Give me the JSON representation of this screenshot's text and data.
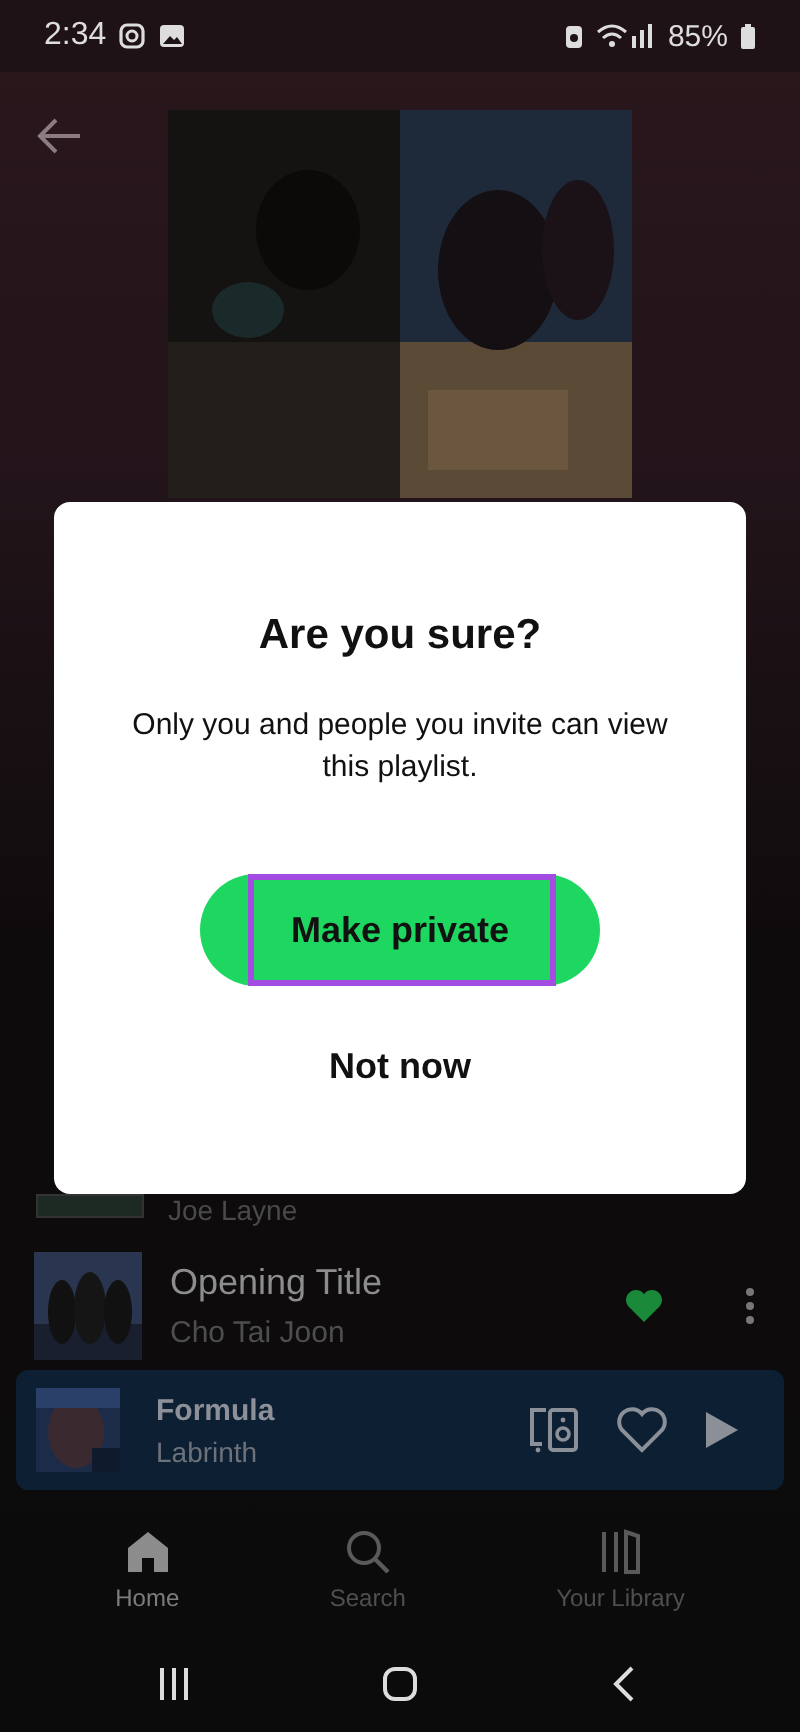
{
  "status_bar": {
    "time": "2:34",
    "battery": "85%"
  },
  "partial_track": {
    "artist": "Joe Layne"
  },
  "tracks": [
    {
      "title": "Opening Title",
      "artist": "Cho Tai Joon",
      "liked": true
    }
  ],
  "dialog": {
    "title": "Are you sure?",
    "message": "Only you and people you invite can view this playlist.",
    "buttons": [
      {
        "label": "Make private",
        "kind": "primary",
        "highlighted": true
      },
      {
        "label": "Not now",
        "kind": "text",
        "highlighted": false
      }
    ]
  },
  "now_playing": {
    "title": "Formula",
    "artist": "Labrinth",
    "liked": false
  },
  "nav": [
    {
      "label": "Home",
      "kind": "home",
      "selected": true
    },
    {
      "label": "Search",
      "kind": "search",
      "selected": false
    },
    {
      "label": "Your Library",
      "kind": "library",
      "selected": false
    }
  ]
}
